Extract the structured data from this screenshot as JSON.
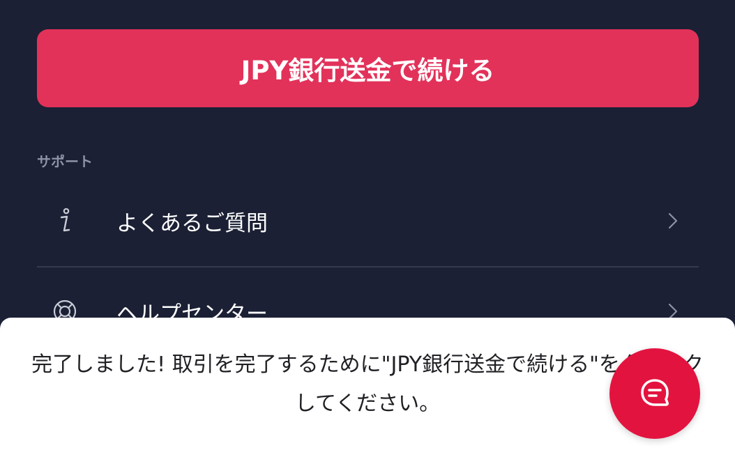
{
  "cta": {
    "label": "JPY銀行送金で続ける",
    "color": "#e2325a"
  },
  "support": {
    "section_label": "サポート",
    "items": [
      {
        "label": "よくあるご質問",
        "icon": "info-icon"
      },
      {
        "label": "ヘルプセンター",
        "icon": "lifebuoy-icon"
      }
    ]
  },
  "toast": {
    "message": "完了しました! 取引を完了するために\"JPY銀行送金で続ける\"をクリックしてください。"
  },
  "chat": {
    "icon": "chat-icon",
    "color": "#e3133f"
  },
  "theme": {
    "background": "#1b2034",
    "muted_text": "#8d93a8",
    "divider": "#33394f"
  }
}
